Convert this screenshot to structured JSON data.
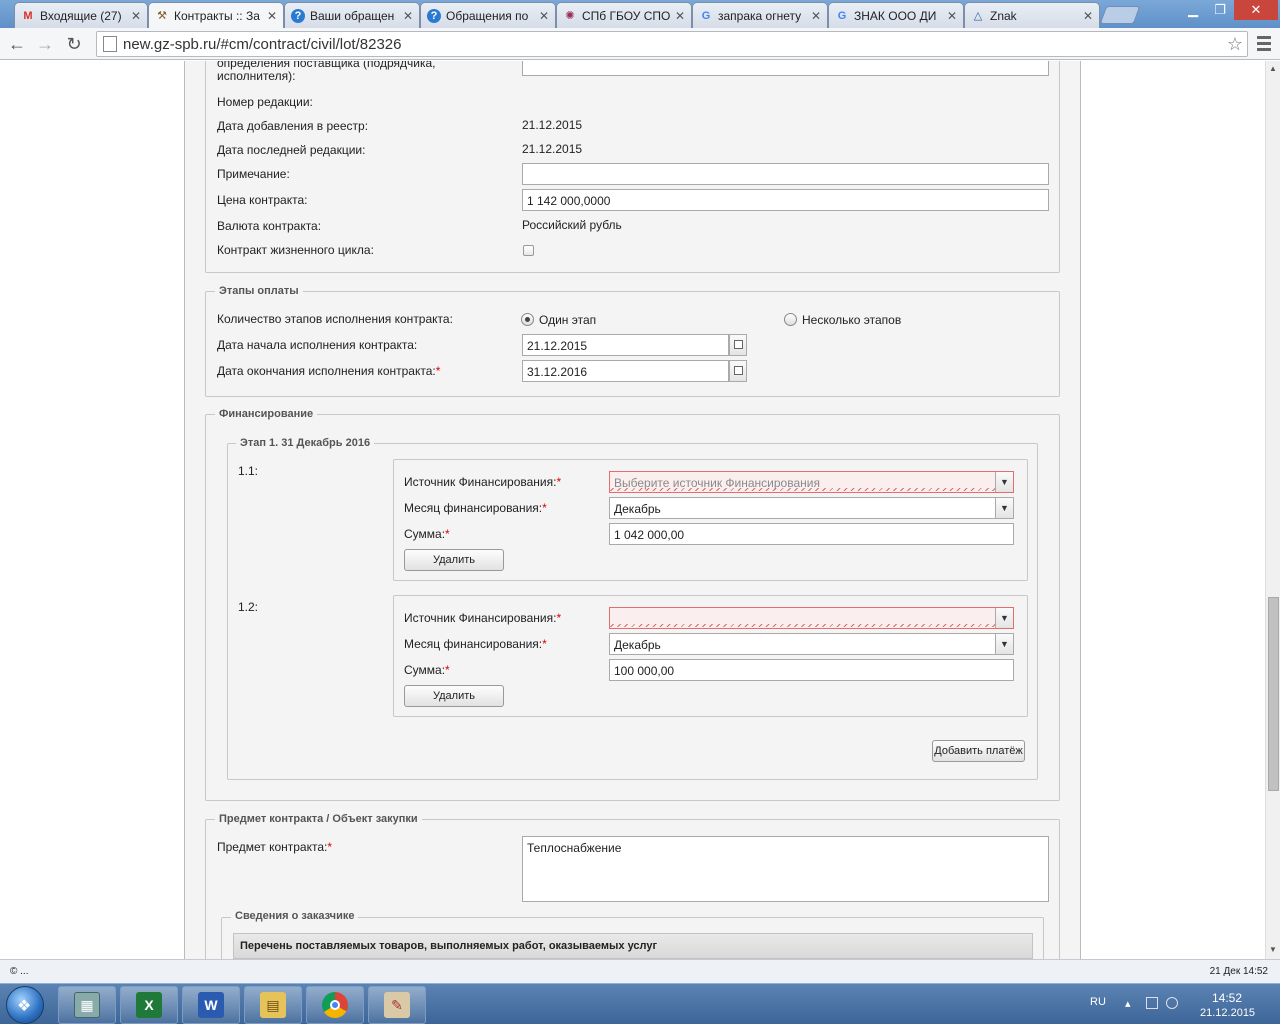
{
  "browser": {
    "tabs": [
      {
        "title": "Входящие (27)",
        "icon": "gmail-icon",
        "color": "#d93025"
      },
      {
        "title": "Контракты :: За",
        "icon": "tools-icon",
        "color": "#8a5a2a"
      },
      {
        "title": "Ваши обращен",
        "icon": "help-icon",
        "color": "#2a7ad1"
      },
      {
        "title": "Обращения по",
        "icon": "help-icon",
        "color": "#2a7ad1"
      },
      {
        "title": "СПб ГБОУ СПО",
        "icon": "site-icon",
        "color": "#9b2b4f"
      },
      {
        "title": "запрака огнету",
        "icon": "google-icon",
        "color": "#4285f4"
      },
      {
        "title": "ЗНАК ООО ДИ",
        "icon": "google-icon",
        "color": "#4285f4"
      },
      {
        "title": "Znak",
        "icon": "znak-icon",
        "color": "#2d5aa0"
      }
    ],
    "url": "new.gz-spb.ru/#cm/contract/civil/lot/82326"
  },
  "contract": {
    "supplier_method_label": "определения поставщика (подрядчика, исполнителя):",
    "edition_number_label": "Номер редакции:",
    "date_added_label": "Дата добавления в реестр:",
    "date_added_value": "21.12.2015",
    "date_last_edit_label": "Дата последней редакции:",
    "date_last_edit_value": "21.12.2015",
    "note_label": "Примечание:",
    "note_value": "",
    "price_label": "Цена контракта:",
    "price_value": "1 142 000,0000",
    "currency_label": "Валюта контракта:",
    "currency_value": "Российский рубль",
    "lifecycle_label": "Контракт жизненного цикла:"
  },
  "stages": {
    "legend": "Этапы оплаты",
    "count_label": "Количество этапов исполнения контракта:",
    "option_one": "Один этап",
    "option_many": "Несколько этапов",
    "start_label": "Дата начала исполнения контракта:",
    "start_value": "21.12.2015",
    "end_label": "Дата окончания исполнения контракта:",
    "end_value": "31.12.2016",
    "required_mark": "*"
  },
  "financing": {
    "legend": "Финансирование",
    "stage_legend": "Этап 1. 31 Декабрь 2016",
    "payments": [
      {
        "index": "1.1:",
        "source_label": "Источник Финансирования:",
        "source_placeholder": "Выберите источник Финансирования",
        "month_label": "Месяц финансирования:",
        "month_value": "Декабрь",
        "sum_label": "Сумма:",
        "sum_value": "1 042 000,00",
        "delete_label": "Удалить"
      },
      {
        "index": "1.2:",
        "source_label": "Источник Финансирования:",
        "source_placeholder": "",
        "month_label": "Месяц финансирования:",
        "month_value": "Декабрь",
        "sum_label": "Сумма:",
        "sum_value": "100 000,00",
        "delete_label": "Удалить"
      }
    ],
    "add_payment_label": "Добавить платёж"
  },
  "subject": {
    "legend": "Предмет контракта / Объект закупки",
    "subject_label": "Предмет контракта:",
    "subject_value": "Теплоснабжение",
    "customer_legend": "Сведения о заказчике",
    "goods_header": "Перечень поставляемых товаров, выполняемых работ, оказываемых услуг"
  },
  "statusbar": {
    "left": "© ...",
    "right": "21 Дек 14:52"
  },
  "taskbar": {
    "apps": [
      "calculator-icon",
      "excel-icon",
      "word-icon",
      "explorer-icon",
      "chrome-icon",
      "paint-icon"
    ],
    "lang": "RU",
    "time": "14:52",
    "date": "21.12.2015"
  }
}
